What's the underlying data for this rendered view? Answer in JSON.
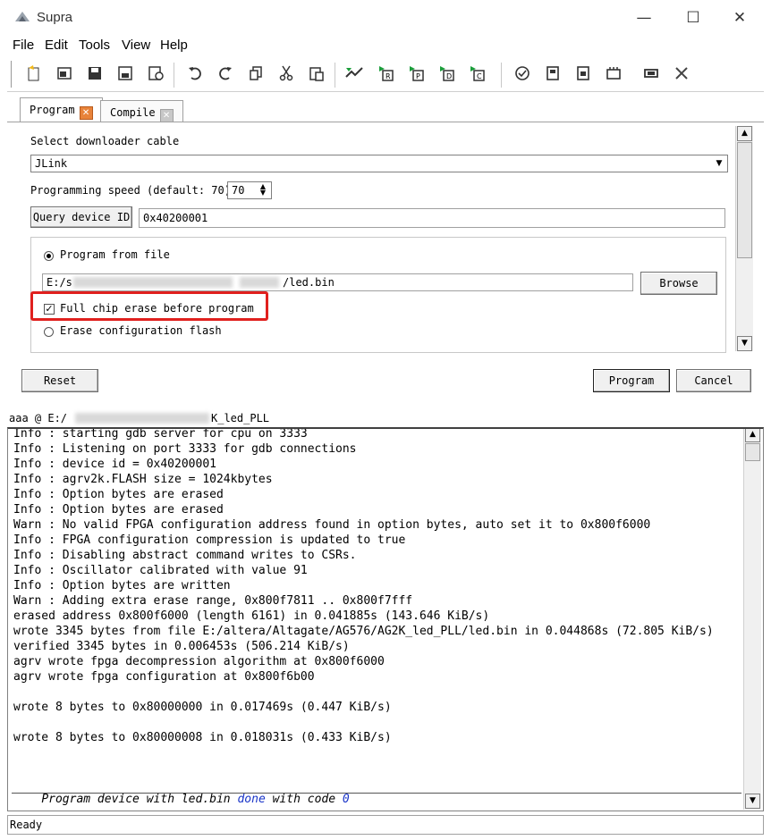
{
  "window": {
    "title": "Supra",
    "controls": {
      "minimize": "—",
      "maximize": "☐",
      "close": "✕"
    }
  },
  "menu": [
    "File",
    "Edit",
    "Tools",
    "View",
    "Help"
  ],
  "toolbar": {
    "icons": [
      "new-project-icon",
      "open-icon",
      "save-icon",
      "save-as-icon",
      "settings-icon",
      "undo-icon",
      "redo-icon",
      "copy-icon",
      "cut-icon",
      "paste-icon",
      "analyze-icon",
      "run-r-icon",
      "run-p-icon",
      "run-d-icon",
      "run-c-icon",
      "check-icon",
      "chip-icon",
      "chip-alt-icon",
      "programmer-icon",
      "device-icon",
      "clear-icon"
    ]
  },
  "tabs": [
    {
      "label": "Program",
      "active": true
    },
    {
      "label": "Compile",
      "active": false
    }
  ],
  "program_panel": {
    "select_cable_label": "Select downloader cable",
    "cable_value": "JLink",
    "speed_label": "Programming speed (default: 70)",
    "speed_value": "70",
    "query_button": "Query device ID",
    "device_id": "0x40200001",
    "program_from_file_label": "Program from file",
    "file_path_start": "E:/s",
    "file_path_end": "/led.bin",
    "browse_button": "Browse",
    "full_erase_label": "Full chip erase before program",
    "full_erase_checked": true,
    "erase_config_label": "Erase configuration flash",
    "reset_button": "Reset",
    "program_button": "Program",
    "cancel_button": "Cancel"
  },
  "log_header": {
    "prefix": "aaa @ E:/",
    "suffix": "K_led_PLL"
  },
  "log": {
    "lines": [
      "Info : starting gdb server for cpu on 3333",
      "Info : Listening on port 3333 for gdb connections",
      "Info : device id = 0x40200001",
      "Info : agrv2k.FLASH size = 1024kbytes",
      "Info : Option bytes are erased",
      "Info : Option bytes are erased",
      "Warn : No valid FPGA configuration address found in option bytes, auto set it to 0x800f6000",
      "Info : FPGA configuration compression is updated to true",
      "Info : Disabling abstract command writes to CSRs.",
      "Info : Oscillator calibrated with value 91",
      "Info : Option bytes are written",
      "Warn : Adding extra erase range, 0x800f7811 .. 0x800f7fff",
      "erased address 0x800f6000 (length 6161) in 0.041885s (143.646 KiB/s)",
      "wrote 3345 bytes from file E:/altera/Altagate/AG576/AG2K_led_PLL/led.bin in 0.044868s (72.805 KiB/s)",
      "verified 3345 bytes in 0.006453s (506.214 KiB/s)",
      "agrv wrote fpga decompression algorithm at 0x800f6000",
      "agrv wrote fpga configuration at 0x800f6b00",
      "",
      "wrote 8 bytes to 0x80000000 in 0.017469s (0.447 KiB/s)",
      "",
      "wrote 8 bytes to 0x80000008 in 0.018031s (0.433 KiB/s)"
    ],
    "done": {
      "a": "Program device with led.bin ",
      "b": "done",
      "c": " with code ",
      "d": "0"
    }
  },
  "status": "Ready",
  "colors": {
    "highlight": "#e0201e",
    "tab_close": "#e8833a",
    "done_blue": "#1a35c8"
  }
}
